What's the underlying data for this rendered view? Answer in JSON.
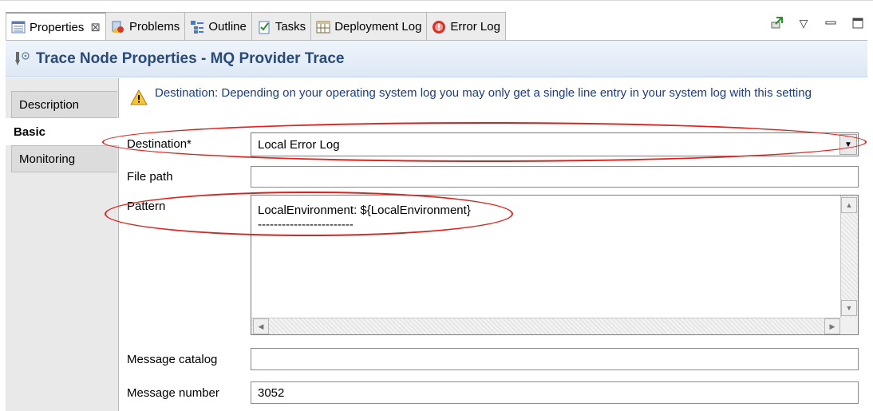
{
  "tabs": [
    {
      "label": "Properties",
      "icon": "properties-icon",
      "active": true,
      "closable": true
    },
    {
      "label": "Problems",
      "icon": "problems-icon"
    },
    {
      "label": "Outline",
      "icon": "outline-icon"
    },
    {
      "label": "Tasks",
      "icon": "tasks-icon"
    },
    {
      "label": "Deployment Log",
      "icon": "deployment-log-icon"
    },
    {
      "label": "Error Log",
      "icon": "error-log-icon"
    }
  ],
  "toolbar": {
    "pin_icon": "pin-icon",
    "menu_icon": "view-menu-icon",
    "minimize_icon": "minimize-icon",
    "maximize_icon": "maximize-icon"
  },
  "header": {
    "title": "Trace Node Properties - MQ Provider Trace",
    "icon": "trace-node-icon"
  },
  "sidetabs": [
    {
      "label": "Description"
    },
    {
      "label": "Basic",
      "active": true
    },
    {
      "label": "Monitoring"
    }
  ],
  "warning": {
    "text": "Destination: Depending on your operating system log you may only get a single line entry in your system log with this setting",
    "icon": "warning-icon"
  },
  "form": {
    "destination_label": "Destination*",
    "destination_value": "Local Error Log",
    "filepath_label": "File path",
    "filepath_value": "",
    "pattern_label": "Pattern",
    "pattern_value": "LocalEnvironment: ${LocalEnvironment}\n------------------------",
    "catalog_label": "Message catalog",
    "catalog_value": "",
    "number_label": "Message number",
    "number_value": "3052"
  },
  "colors": {
    "annotation": "#e0201b",
    "title": "#2a4a7a",
    "warning_text": "#1d3c86"
  }
}
